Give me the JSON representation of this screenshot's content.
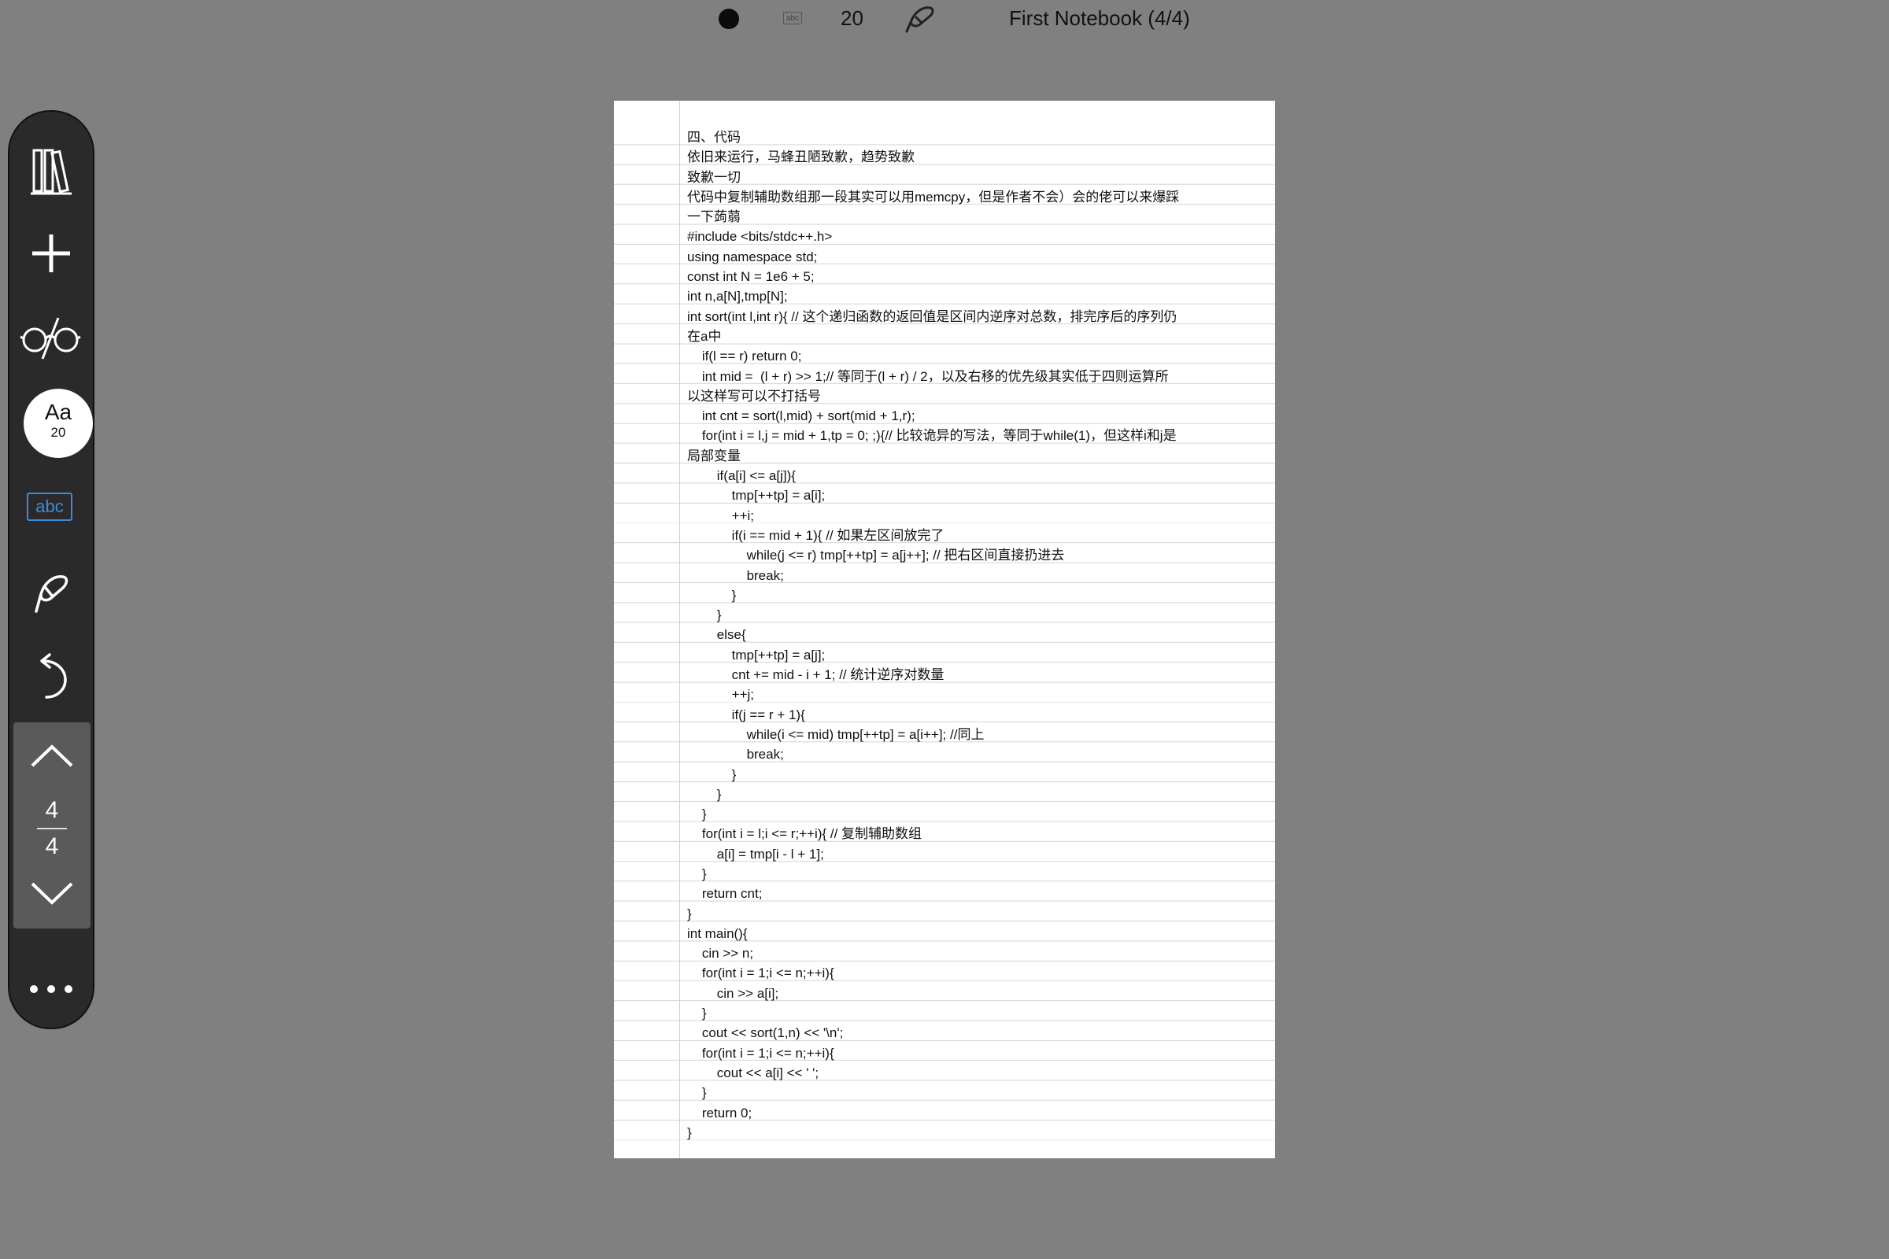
{
  "topbar": {
    "size_value": "20",
    "notebook_title": "First Notebook (4/4)"
  },
  "toolbar": {
    "icons": [
      "library-icon",
      "add-icon",
      "glasses-icon",
      "font-size-button",
      "text-recognition-icon",
      "pen-icon",
      "undo-icon",
      "page-up-icon",
      "page-down-icon",
      "more-icon"
    ],
    "font_label": "Aa",
    "font_size": "20",
    "abc_label": "abc",
    "current_page": "4",
    "total_pages": "4",
    "accent_color": "#3a8dde"
  },
  "document": {
    "lines": [
      "四、代码",
      "依旧来运行，马蜂丑陋致歉，趋势致歉",
      "致歉一切",
      "代码中复制辅助数组那一段其实可以用memcpy，但是作者不会）会的佬可以来爆踩",
      "一下蒟蒻",
      "#include <bits/stdc++.h>",
      "using namespace std;",
      "const int N = 1e6 + 5;",
      "int n,a[N],tmp[N];",
      "int sort(int l,int r){ // 这个递归函数的返回值是区间内逆序对总数，排完序后的序列仍",
      "在a中",
      "    if(l == r) return 0;",
      "    int mid =  (l + r) >> 1;// 等同于(l + r) / 2，以及右移的优先级其实低于四则运算所",
      "以这样写可以不打括号",
      "    int cnt = sort(l,mid) + sort(mid + 1,r);",
      "    for(int i = l,j = mid + 1,tp = 0; ;){// 比较诡异的写法，等同于while(1)，但这样i和j是",
      "局部变量",
      "        if(a[i] <= a[j]){",
      "            tmp[++tp] = a[i];",
      "            ++i;",
      "            if(i == mid + 1){ // 如果左区间放完了",
      "                while(j <= r) tmp[++tp] = a[j++]; // 把右区间直接扔进去",
      "                break;",
      "            }",
      "        }",
      "        else{",
      "            tmp[++tp] = a[j];",
      "            cnt += mid - i + 1; // 统计逆序对数量",
      "            ++j;",
      "            if(j == r + 1){",
      "                while(i <= mid) tmp[++tp] = a[i++]; //同上",
      "                break;",
      "            }",
      "        }",
      "    }",
      "    for(int i = l;i <= r;++i){ // 复制辅助数组",
      "        a[i] = tmp[i - l + 1];",
      "    }",
      "    return cnt;",
      "}",
      "int main(){",
      "    cin >> n;",
      "    for(int i = 1;i <= n;++i){",
      "        cin >> a[i];",
      "    }",
      "    cout << sort(1,n) << '\\n';",
      "    for(int i = 1;i <= n;++i){",
      "        cout << a[i] << ' ';",
      "    }",
      "    return 0;",
      "}"
    ]
  }
}
